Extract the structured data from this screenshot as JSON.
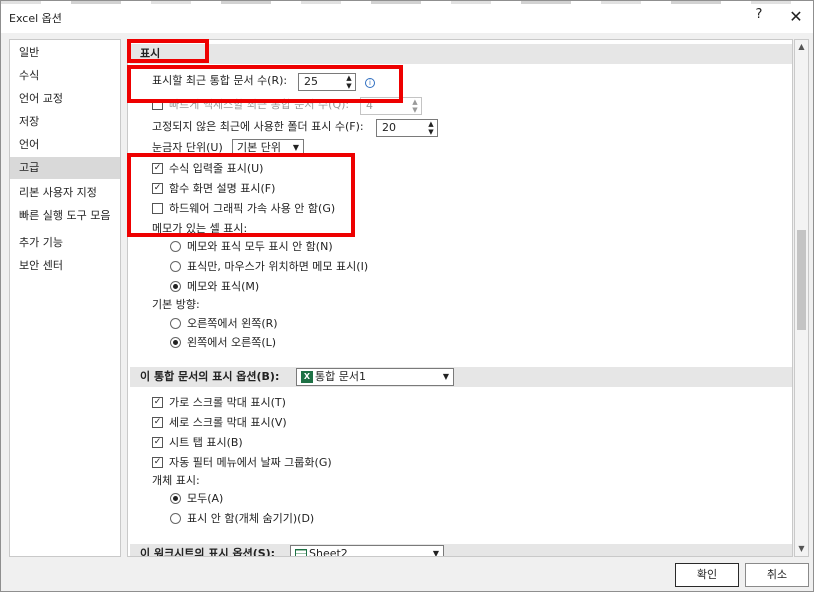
{
  "window": {
    "title": "Excel 옵션",
    "help": "?",
    "close": "✕"
  },
  "nav": {
    "items": [
      {
        "label": "일반"
      },
      {
        "label": "수식"
      },
      {
        "label": "언어 교정"
      },
      {
        "label": "저장"
      },
      {
        "label": "언어"
      },
      {
        "label": "고급",
        "active": true
      },
      {
        "label": "리본 사용자 지정"
      },
      {
        "label": "빠른 실행 도구 모음"
      },
      {
        "label": "추가 기능"
      },
      {
        "label": "보안 센터"
      }
    ]
  },
  "display": {
    "header": "표시",
    "recent_docs_label": "표시할 최근 통합 문서 수(R):",
    "recent_docs_value": "25",
    "hidden_row_label": "빠르게 액세스할 최근 통합 문서 수(Q):",
    "hidden_row_value": "4",
    "recent_folders_label": "고정되지 않은 최근에 사용한 폴더 표시 수(F):",
    "recent_folders_value": "20",
    "ruler_label": "눈금자 단위(U)",
    "ruler_value": "기본 단위",
    "formula_bar": "수식 입력줄 표시(U)",
    "func_tooltips": "함수 화면 설명 표시(F)",
    "hw_accel": "하드웨어 그래픽 가속 사용 안 함(G)",
    "comments_label": "메모가 있는 셀 표시:",
    "comments_none": "메모와 표식 모두 표시 안 함(N)",
    "comments_indicator": "표식만, 마우스가 위치하면 메모 표시(I)",
    "comments_both": "메모와 표식(M)",
    "direction_label": "기본 방향:",
    "rtl": "오른쪽에서 왼쪽(R)",
    "ltr": "왼쪽에서 오른쪽(L)"
  },
  "workbook": {
    "header": "이 통합 문서의 표시 옵션(B):",
    "select": "통합 문서1",
    "hscroll": "가로 스크롤 막대 표시(T)",
    "vscroll": "세로 스크롤 막대 표시(V)",
    "sheet_tabs": "시트 탭 표시(B)",
    "autofilter_dates": "자동 필터 메뉴에서 날짜 그룹화(G)",
    "objects_label": "개체 표시:",
    "objects_all": "모두(A)",
    "objects_none": "표시 안 함(개체 숨기기)(D)"
  },
  "worksheet": {
    "header": "이 워크시트의 표시 옵션(S):",
    "select": "Sheet2"
  },
  "buttons": {
    "ok": "확인",
    "cancel": "취소"
  }
}
